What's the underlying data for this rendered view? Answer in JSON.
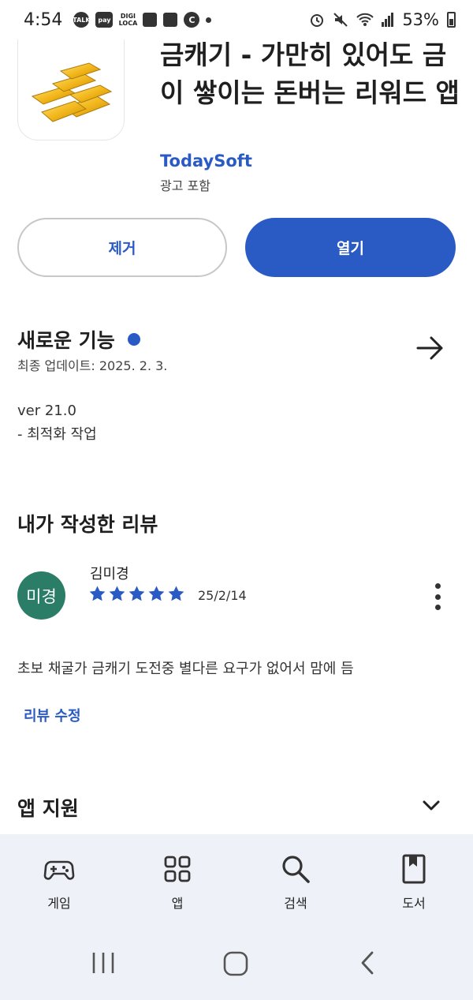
{
  "status_bar": {
    "time": "4:54",
    "notif_icons": [
      "TALK",
      "pay",
      "DIGI LOCA"
    ],
    "battery": "53%"
  },
  "app": {
    "title": "금캐기 - 가만히 있어도 금이 쌓이는 돈버는 리워드 앱",
    "developer": "TodaySoft",
    "ad_note": "광고 포함"
  },
  "actions": {
    "remove_label": "제거",
    "open_label": "열기"
  },
  "whats_new": {
    "title": "새로운 기능",
    "updated": "최종 업데이트: 2025. 2. 3.",
    "version": "ver 21.0",
    "note": "- 최적화 작업"
  },
  "my_review": {
    "title": "내가 작성한 리뷰",
    "avatar_text": "미경",
    "reviewer": "김미경",
    "rating": 5,
    "date": "25/2/14",
    "text": "초보 채굴가 금캐기 도전중 별다른 요구가 없어서 맘에 듬",
    "edit_label": "리뷰 수정"
  },
  "app_support": {
    "title": "앱 지원"
  },
  "bottom_nav": [
    {
      "label": "게임",
      "icon": "gamepad-icon"
    },
    {
      "label": "앱",
      "icon": "apps-grid-icon"
    },
    {
      "label": "검색",
      "icon": "search-icon"
    },
    {
      "label": "도서",
      "icon": "book-icon"
    }
  ],
  "colors": {
    "accent": "#2a5bc4",
    "avatar_bg": "#2b7d68",
    "nav_bg": "#eef2f8"
  }
}
